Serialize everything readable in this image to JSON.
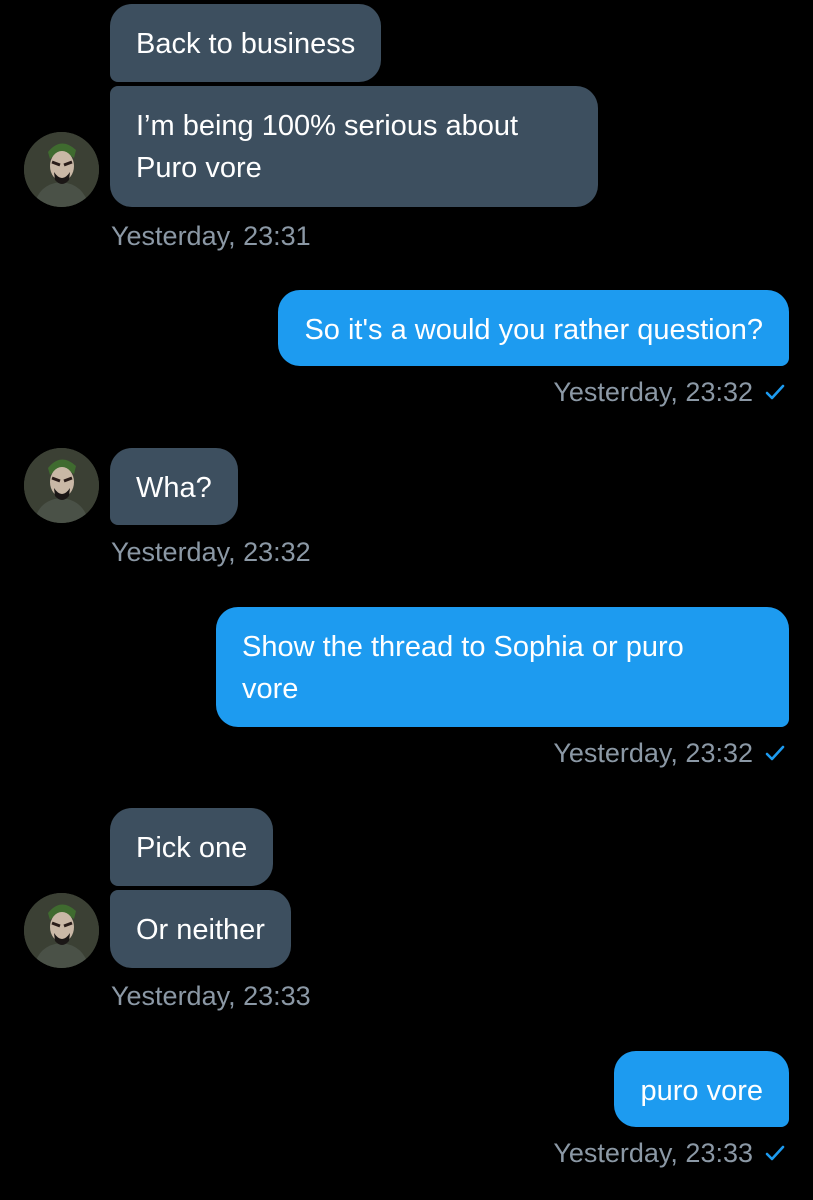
{
  "messages": {
    "m1": "Back to business",
    "m2": "I’m being 100% serious about Puro vore",
    "m3": "So it's a would you rather question?",
    "m4": "Wha?",
    "m5_line1": "Show the thread to Sophia or puro",
    "m5_line2": "vore",
    "m6": "Pick one",
    "m7": "Or neither",
    "m8": "puro vore"
  },
  "timestamps": {
    "t1": "Yesterday, 23:31",
    "t2": "Yesterday, 23:32",
    "t3": "Yesterday, 23:32",
    "t4": "Yesterday, 23:32",
    "t5": "Yesterday, 23:33",
    "t6": "Yesterday, 23:33"
  },
  "icons": {
    "read_receipt": "check-icon",
    "avatar": "user-avatar"
  },
  "colors": {
    "background": "#000000",
    "incoming_bubble": "#3d4f5f",
    "outgoing_bubble": "#1d9bf0",
    "timestamp": "#8b98a5",
    "check": "#1d9bf0"
  }
}
